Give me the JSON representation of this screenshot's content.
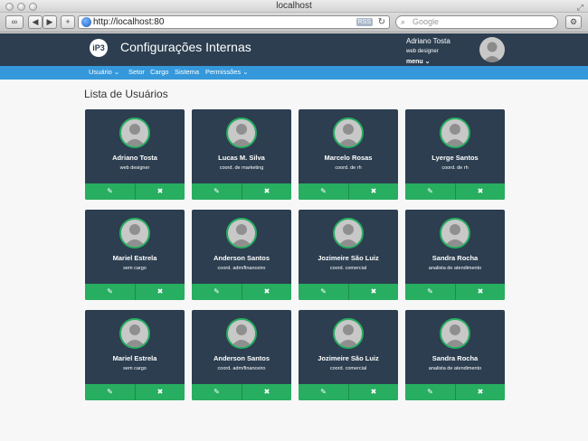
{
  "browser": {
    "window_title": "localhost",
    "url": "http://localhost:80",
    "rss_label": "RSS",
    "search_placeholder": "Google"
  },
  "app": {
    "logo_text": "iP3",
    "title": "Configurações Internas"
  },
  "user": {
    "name": "Adriano Tosta",
    "role": "web designer",
    "menu_label": "menu ⌄"
  },
  "nav": {
    "items": [
      {
        "label": "Usuário ⌄"
      },
      {
        "label": "Setor"
      },
      {
        "label": "Cargo"
      },
      {
        "label": "Sistema"
      },
      {
        "label": "Permissões ⌄"
      }
    ]
  },
  "page": {
    "title": "Lista de Usuários"
  },
  "cards": [
    {
      "name": "Adriano Tosta",
      "role": "web designer"
    },
    {
      "name": "Lucas M. Silva",
      "role": "coord. de marketing"
    },
    {
      "name": "Marcelo Rosas",
      "role": "coord. de rh"
    },
    {
      "name": "Lyerge Santos",
      "role": "coord. de rh"
    },
    {
      "name": "Mariel Estrela",
      "role": "sem cargo"
    },
    {
      "name": "Anderson Santos",
      "role": "coord. adm/financeiro"
    },
    {
      "name": "Jozimeire São Luiz",
      "role": "coord. comercial"
    },
    {
      "name": "Sandra Rocha",
      "role": "analista de atendimento"
    },
    {
      "name": "Mariel Estrela",
      "role": "sem cargo"
    },
    {
      "name": "Anderson Santos",
      "role": "coord. adm/financeiro"
    },
    {
      "name": "Jozimeire São Luiz",
      "role": "coord. comercial"
    },
    {
      "name": "Sandra Rocha",
      "role": "analista de atendimento"
    }
  ],
  "card_actions": {
    "edit_icon": "edit-icon",
    "delete_icon": "close-icon",
    "edit_glyph": "✎",
    "delete_glyph": "✖"
  },
  "colors": {
    "header": "#2c3e50",
    "nav": "#3498db",
    "card": "#2c3e50",
    "accent": "#27ae60"
  }
}
